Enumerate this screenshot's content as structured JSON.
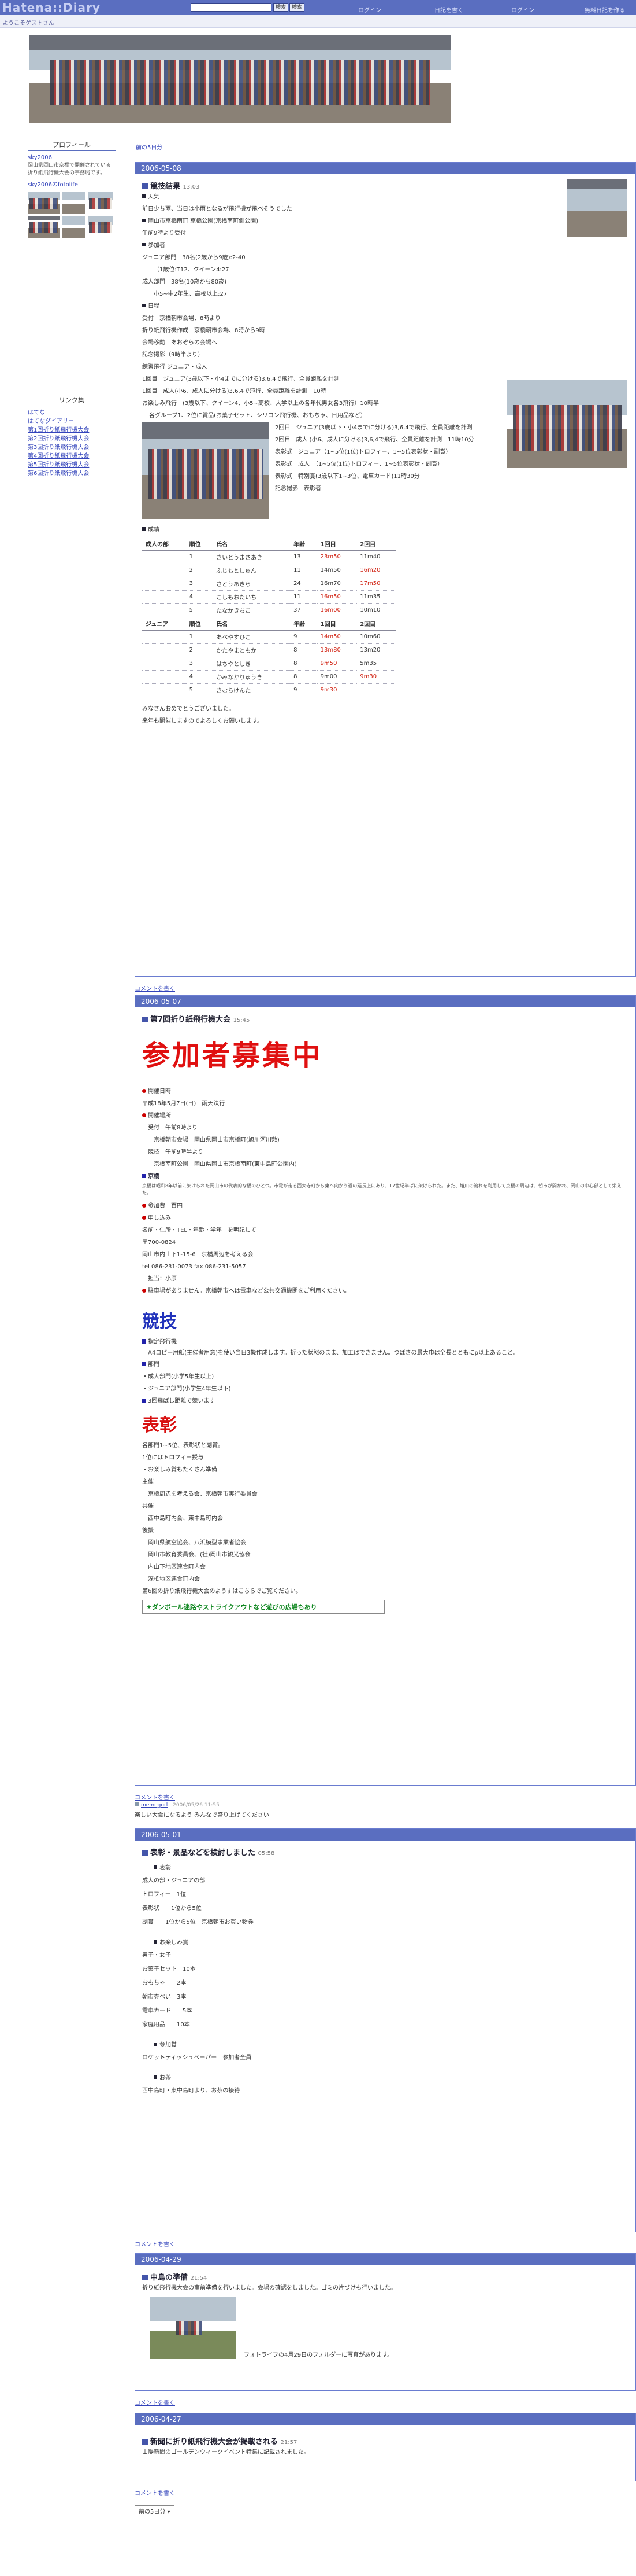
{
  "topbar": {
    "logo": "Hatena::Diary",
    "search_btn": "検索",
    "search_btn2": "検索",
    "links": [
      "ログイン",
      "日記を書く",
      "ログイン",
      "無料日記を作る"
    ]
  },
  "subbar": {
    "welcome": "ようこそゲストさん"
  },
  "sidebar": {
    "profile_title": "プロフィール",
    "profile_user": "sky2006",
    "profile_desc": "岡山県岡山市京橋で開催されている折り紙飛行機大会の事務局です。",
    "profile_link": "sky2006のfotolife",
    "link_title": "リンク集",
    "links": [
      "はてな",
      "はてなダイアリー",
      "第1回折り紙飛行機大会",
      "第2回折り紙飛行機大会",
      "第3回折り紙飛行機大会",
      "第4回折り紙飛行機大会",
      "第5回折り紙飛行機大会",
      "第6回折り紙飛行機大会"
    ]
  },
  "nav": {
    "prev_days": "前の5日分",
    "next_days": "前の5日分"
  },
  "days": [
    {
      "date": "2006-05-08",
      "title": "競技結果",
      "time": "13:03",
      "weather_h": "天気",
      "weather": "前日少ち雨、当日は小雨となるが飛行機が飛べそうでした",
      "venue_h": "会場",
      "venue": "岡山市京橋南町 京橋公園(京橋南町側公園)",
      "morning": "午前9時より受付",
      "participants_h": "参加者",
      "jr": "ジュニア部門　38名(2歳から9歳):2-40",
      "jr2": "（1歳位:T12、クイーン4:27",
      "adult": "成人部門　38名(10歳から80歳)",
      "adult2": "小5~中2年生、高校以上:27",
      "schedule_h": "日程",
      "schedule": [
        "受付　京橋朝市会場、8時より",
        "折り紙飛行機作成　京橋朝市会場、8時から9時",
        "会場移動　あおぞらの会場へ",
        "記念撮影（9時半より）",
        "練習飛行  ジュニア・成人",
        "1回目　ジュニア(3歳以下・小4までに分ける)3,6,4で飛行、全員距離を計測",
        "1回目　成人(小6、成人に分ける)3,6,4で飛行、全員距離を計測　10時",
        "お楽しみ飛行　(3歳以下、クイーン4、小5~高校、大学以上の各年代男女各3飛行）10時半",
        "各グループ1、2位に賞品(お菓子セット、シリコン飛行機、おもちゃ、日用品など）",
        "2回目　ジュニア(3歳以下・小4までに分ける)3,6,4で飛行、全員距離を計測",
        "2回目　成人 (小6、成人に分ける)3,6,4で飛行、全員距離を計測　11時10分",
        "表彰式　ジュニア（1~5位(1位)トロフィー、1~5位表彰状・副賞）",
        "表彰式　成人　（1~5位(1位)トロフィー、1~5位表彰状・副賞）",
        "表彰式　特別賞(3歳以下1~3位、電車カード)11時30分",
        "記念撮影　表彰者"
      ],
      "results_h": "成績",
      "adult_table": {
        "headers": [
          "成人の部",
          "順位",
          "氏名",
          "年齢",
          "1回目",
          "2回目"
        ],
        "rows": [
          [
            "",
            "1",
            "きいとうまさあき",
            "13",
            "23m50",
            "11m40"
          ],
          [
            "",
            "2",
            "ふじもとしゅん",
            "11",
            "14m50",
            "16m20"
          ],
          [
            "",
            "3",
            "さとうあきら",
            "24",
            "16m70",
            "17m50"
          ],
          [
            "",
            "4",
            "こしもおたいち",
            "11",
            "16m50",
            "11m35"
          ],
          [
            "",
            "5",
            "たなかきちこ",
            "37",
            "16m00",
            "10m10"
          ]
        ]
      },
      "junior_table": {
        "headers": [
          "ジュニア",
          "順位",
          "氏名",
          "年齢",
          "1回目",
          "2回目"
        ],
        "rows": [
          [
            "",
            "1",
            "あべやすひこ",
            "9",
            "14m50",
            "10m60"
          ],
          [
            "",
            "2",
            "かたやまともか",
            "8",
            "13m80",
            "13m20"
          ],
          [
            "",
            "3",
            "はちやとしき",
            "8",
            "9m50",
            "5m35"
          ],
          [
            "",
            "4",
            "かみなかりゅうき",
            "8",
            "9m00",
            "9m30"
          ],
          [
            "",
            "5",
            "きむらけんた",
            "9",
            "9m30",
            ""
          ]
        ]
      },
      "thanks": "みなさんおめでとうございました。",
      "next": "来年も開催しますのでよろしくお願いします。",
      "comment_link": "コメントを書く"
    },
    {
      "date": "2006-05-07",
      "title": "第7回折り紙飛行機大会",
      "time": "15:45",
      "recruit": "参加者募集中",
      "date_h": "開催日時",
      "date_v": "平成18年5月7日(日)　雨天決行",
      "place_h": "開催場所",
      "place_v1": "受付　午前8時より",
      "place_v2": "京橋朝市会場　岡山県岡山市京橋町(旭川河川敷)",
      "place_v3": "競技　午前9時半より",
      "place_v4": "京橋南町公園　岡山県岡山市京橋南町(東中島町公園内)",
      "note_h": "京橋",
      "note": "京橋は昭和8年以前に架けられた岡山市の代表的な橋のひとつ。市電が走る西大寺町から東へ向かう道の延長上にあり、17世紀半ばに架けられた。また、旭川の流れを利用して京橋の周辺は、朝市が開かれ、岡山の中心部として栄えた。",
      "fee_h": "参加費　百円",
      "apply_h": "申し込み",
      "apply1": "名前・住所・TEL・年齢・学年　を明記して",
      "apply2": "〒700-0824",
      "apply3": "岡山市内山下1-15-6　京橋周辺を考える会",
      "apply4": "tel 086-231-0073 fax 086-231-5057",
      "apply5": "担当：小原",
      "car": "駐車場がありません。京橋朝市へは電車など公共交通機関をご利用ください。",
      "compete": "競技",
      "rule_h": "指定飛行機",
      "rule": "A4コピー用紙(主催者用意)を使い当日3機作成します。折った状態のまま、加工はできません。つばさの最大巾は全長とともにp以上あること。",
      "div_h": "部門",
      "div1": "・成人部門(小学5年生以上)",
      "div2": "・ジュニア部門(小学生4年生以下)",
      "div3": "3回飛ばし距離で競います",
      "award": "表彰",
      "award1": "各部門1~5位、表彰状と副賞。",
      "award2": "1位にはトロフィー授与",
      "award3": "・お楽しみ賞もたくさん準備",
      "org_h": "主催",
      "org1": "京橋周辺を考える会、京橋朝市実行委員会",
      "org2_h": "共催",
      "org2": "西中島町内会、東中島町内会",
      "org3_h": "後援",
      "org3": [
        "岡山県航空協会、八浜模型事業者協会",
        "岡山市教育委員会、(社)岡山市観光協会",
        "内山下地区連合町内会",
        "深柢地区連合町内会"
      ],
      "past": "第6回の折り紙飛行機大会のようすはこちらでご覧ください。",
      "banner": "ダンボール迷路やストライクアウトなど遊びの広場もあり",
      "comment_link": "コメントを書く",
      "comment_user": "memegurl",
      "comment_time": "2006/05/26 11:55",
      "comment_text": "楽しい大会になるよう みんなで盛り上げてください"
    },
    {
      "date": "2006-05-01",
      "title": "表彰・景品などを検討しました",
      "time": "05:58",
      "h1": "表彰",
      "l1": [
        "成人の部・ジュニアの部",
        "トロフィー　1位",
        "表彰状　　1位から5位",
        "副賞　　1位から5位　京橋朝市お買い物券"
      ],
      "h2": "お楽しみ賞",
      "l2": [
        "男子・女子",
        "お菓子セット　10本",
        "おもちゃ　　2本",
        "朝市券ぺい　3本",
        "電車カード　　5本",
        "家庭用品　　10本"
      ],
      "h3": "参加賞",
      "l3": [
        "ロケットティッシュペーパー　参加者全員"
      ],
      "h4": "お茶",
      "l4": [
        "西中島町・東中島町より、お茶の接待"
      ],
      "comment_link": "コメントを書く"
    },
    {
      "date": "2006-04-29",
      "title": "中島の準備",
      "time": "21:54",
      "text": "折り紙飛行機大会の事前準備を行いました。会場の確認をしました。ゴミの片づけも行いました。",
      "caption": "フォトライフの4月29日のフォルダーに写真があります。",
      "comment_link": "コメントを書く"
    },
    {
      "date": "2006-04-27",
      "title": "新聞に折り紙飛行機大会が掲載される",
      "time": "21:57",
      "text": "山陽新聞のゴールデンウィークイベント特集に記載されました。",
      "comment_link": "コメントを書く"
    }
  ],
  "colors": {
    "accent": "#5a6ec0",
    "red": "#e01010",
    "blue_heading": "#2233bb"
  }
}
